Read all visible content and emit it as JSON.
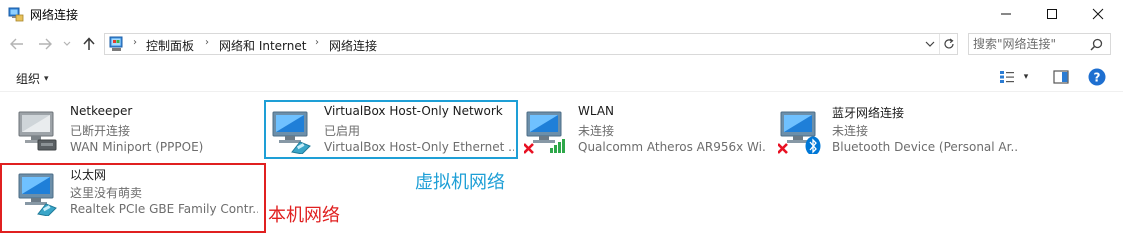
{
  "window": {
    "title": "网络连接",
    "minimize_glyph": "—",
    "maximize_glyph": "☐",
    "close_glyph": "✕"
  },
  "address_bar": {
    "crumbs": [
      "控制面板",
      "网络和 Internet",
      "网络连接"
    ],
    "separator": "›"
  },
  "search": {
    "placeholder": "搜索\"网络连接\""
  },
  "command_bar": {
    "organize_label": "组织",
    "caret": "▾"
  },
  "connections": [
    {
      "name": "Netkeeper",
      "status": "已断开连接",
      "device": "WAN Miniport (PPPOE)",
      "overlay": "cable"
    },
    {
      "name": "VirtualBox Host-Only Network",
      "status": "已启用",
      "device": "VirtualBox Host-Only Ethernet ...",
      "overlay": "cable"
    },
    {
      "name": "WLAN",
      "status": "未连接",
      "device": "Qualcomm Atheros AR956x Wi...",
      "overlay": "wifi-disconnected"
    },
    {
      "name": "蓝牙网络连接",
      "status": "未连接",
      "device": "Bluetooth Device (Personal Ar...",
      "overlay": "bluetooth-disconnected"
    },
    {
      "name": "以太网",
      "status": "这里没有萌卖",
      "device": "Realtek PCIe GBE Family Contr...",
      "overlay": "cable"
    }
  ],
  "annotations": {
    "virtual_label": "虚拟机网络",
    "virtual_color": "#1e9fd6",
    "local_label": "本机网络",
    "local_color": "#e02020"
  },
  "colors": {
    "accent": "#0078d7",
    "disconnected_x": "#e81123",
    "wifi_green": "#2ea84a",
    "bluetooth_blue": "#0078d7"
  }
}
